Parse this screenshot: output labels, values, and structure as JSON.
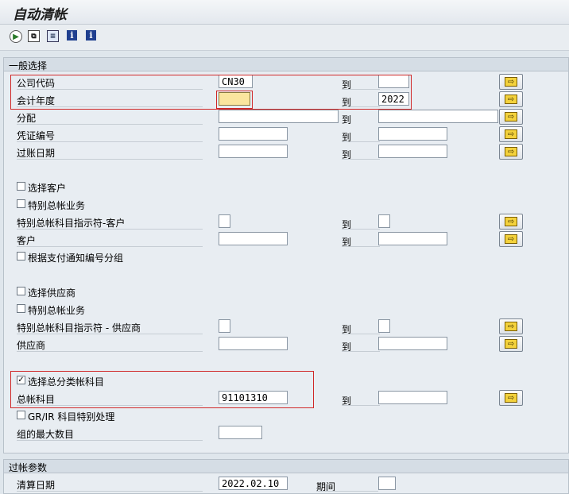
{
  "window": {
    "title": "自动清帐"
  },
  "toolbar": {
    "execute_icon": "execute-icon",
    "copy_icon": "copy-icon",
    "variant_icon": "variant-icon",
    "info_icon": "i"
  },
  "sections": {
    "general": {
      "header": "一般选择",
      "rows": {
        "company_code": {
          "label": "公司代码",
          "from": "CN30",
          "to": ""
        },
        "fiscal_year": {
          "label": "会计年度",
          "from": "",
          "to": "2022"
        },
        "assignment": {
          "label": "分配",
          "from": "",
          "to": ""
        },
        "doc_number": {
          "label": "凭证编号",
          "from": "",
          "to": ""
        },
        "posting_date": {
          "label": "过账日期",
          "from": "",
          "to": ""
        },
        "select_customer": {
          "label": "选择客户",
          "checked": false
        },
        "special_gl_customer_cb": {
          "label": "特别总帐业务",
          "checked": false
        },
        "special_gl_ind_customer": {
          "label": "特别总帐科目指示符-客户",
          "from": "",
          "to": ""
        },
        "customer": {
          "label": "客户",
          "from": "",
          "to": ""
        },
        "group_by_payment_advice": {
          "label": "根据支付通知编号分组",
          "checked": false
        },
        "select_vendor": {
          "label": "选择供应商",
          "checked": false
        },
        "special_gl_vendor_cb": {
          "label": "特别总帐业务",
          "checked": false
        },
        "special_gl_ind_vendor": {
          "label": "特别总帐科目指示符 - 供应商",
          "from": "",
          "to": ""
        },
        "vendor": {
          "label": "供应商",
          "from": "",
          "to": ""
        },
        "select_gl": {
          "label": "选择总分类帐科目",
          "checked": true
        },
        "gl_account": {
          "label": "总帐科目",
          "from": "91101310",
          "to": ""
        },
        "grir_special": {
          "label": "GR/IR 科目特别处理",
          "checked": false
        },
        "max_groups": {
          "label": "组的最大数目",
          "value": ""
        }
      },
      "to_label": "到"
    },
    "posting": {
      "header": "过帐参数",
      "clearing_date": {
        "label": "清算日期",
        "value": "2022.02.10"
      },
      "period": {
        "label": "期间",
        "value": ""
      }
    }
  },
  "colors": {
    "highlight": "#d02828",
    "focus_field": "#fbe59e",
    "arrow_button": "#f4d23c"
  },
  "icons": {
    "multiple_selection": "arrow-right-icon",
    "check_mark": "✓"
  }
}
